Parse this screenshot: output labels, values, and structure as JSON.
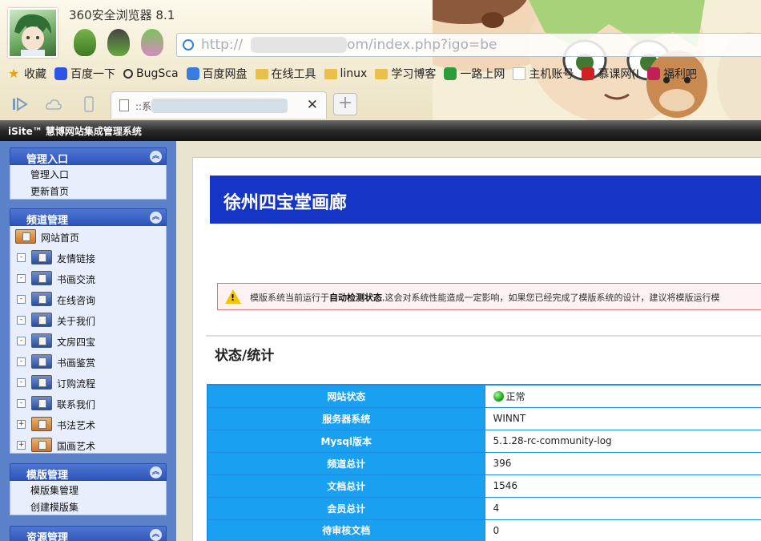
{
  "browser": {
    "title": "360安全浏览器 8.1",
    "address_prefix": "http://",
    "address_suffix": "om/index.php?igo=be",
    "bookmarks": [
      {
        "label": "收藏",
        "icon": "star-icon",
        "color": "#e8a317"
      },
      {
        "label": "百度一下",
        "icon": "baidu-paw-icon",
        "color": "#2e53e6"
      },
      {
        "label": "BugSca",
        "icon": "magnifier-icon",
        "color": "#333333"
      },
      {
        "label": "百度网盘",
        "icon": "cloud-icon",
        "color": "#3a7be0"
      },
      {
        "label": "在线工具",
        "icon": "folder-icon",
        "color": "#e8c04a"
      },
      {
        "label": "linux",
        "icon": "folder-icon",
        "color": "#e8c04a"
      },
      {
        "label": "学习博客",
        "icon": "folder-icon",
        "color": "#e8c04a"
      },
      {
        "label": "一路上网",
        "icon": "site-icon",
        "color": "#2c9b3c"
      },
      {
        "label": "主机账号",
        "icon": "page-icon",
        "color": "#ffffff"
      },
      {
        "label": "慕课网(I",
        "icon": "flame-icon",
        "color": "#d02020"
      },
      {
        "label": "福利吧",
        "icon": "flower-icon",
        "color": "#c0205a"
      }
    ],
    "tab": {
      "title": "::系",
      "close": "✕"
    },
    "new_tab": "+"
  },
  "app": {
    "title": "iSite™ 慧博网站集成管理系统"
  },
  "sidebar": {
    "panels": [
      {
        "title": "管理入口",
        "links": [
          "管理入口",
          "更新首页"
        ]
      },
      {
        "title": "频道管理",
        "root": "网站首页",
        "tree": [
          {
            "label": "友情链接",
            "box": "-",
            "folder": "blue"
          },
          {
            "label": "书画交流",
            "box": "-",
            "folder": "blue"
          },
          {
            "label": "在线咨询",
            "box": "-",
            "folder": "blue"
          },
          {
            "label": "关于我们",
            "box": "-",
            "folder": "blue"
          },
          {
            "label": "文房四宝",
            "box": "-",
            "folder": "blue"
          },
          {
            "label": "书画鉴赏",
            "box": "-",
            "folder": "blue"
          },
          {
            "label": "订购流程",
            "box": "-",
            "folder": "blue"
          },
          {
            "label": "联系我们",
            "box": "-",
            "folder": "blue"
          },
          {
            "label": "书法艺术",
            "box": "+",
            "folder": "orange"
          },
          {
            "label": "国画艺术",
            "box": "+",
            "folder": "orange"
          }
        ]
      },
      {
        "title": "模版管理",
        "links": [
          "模版集管理",
          "创建模版集"
        ]
      },
      {
        "title": "资源管理",
        "links": []
      }
    ]
  },
  "main": {
    "site_name": "徐州四宝堂画廊",
    "warning": {
      "pre": "模版系统当前运行于",
      "bold": "自动检测状态",
      "post": ",这会对系统性能造成一定影响，如果您已经完成了模版系统的设计，建议将模版运行模"
    },
    "section_title": "状态/统计",
    "stats": [
      {
        "key": "网站状态",
        "value": "正常",
        "status": "ok"
      },
      {
        "key": "服务器系统",
        "value": "WINNT"
      },
      {
        "key": "Mysql版本",
        "value": "5.1.28-rc-community-log"
      },
      {
        "key": "频道总计",
        "value": "396"
      },
      {
        "key": "文档总计",
        "value": "1546"
      },
      {
        "key": "会员总计",
        "value": "4"
      },
      {
        "key": "待审核文档",
        "value": "0"
      }
    ]
  }
}
